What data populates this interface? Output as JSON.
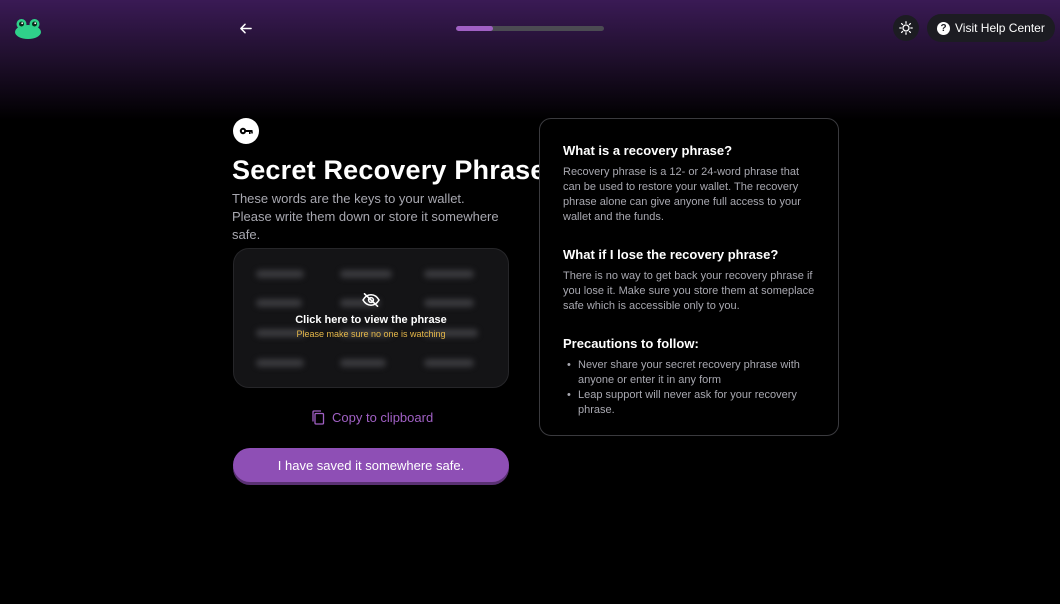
{
  "header": {
    "progress_fraction": 0.25,
    "help_label": "Visit Help Center"
  },
  "main": {
    "title": "Secret Recovery Phrase",
    "subtitle": "These words are the keys to your wallet. Please write them down or store it somewhere safe.",
    "reveal_title": "Click here to view the phrase",
    "reveal_hint": "Please make sure no one is watching",
    "copy_label": "Copy to clipboard",
    "primary_button": "I have saved it somewhere safe."
  },
  "info": {
    "q1_title": "What is a recovery phrase?",
    "q1_body": "Recovery phrase is a 12- or 24-word phrase that can be used to restore your wallet. The recovery phrase alone can give anyone full access to your wallet and the funds.",
    "q2_title": "What if I lose the recovery phrase?",
    "q2_body": "There is no way to get back your recovery phrase if you lose it. Make sure you store them at someplace safe which is accessible only to you.",
    "q3_title": "Precautions to follow:",
    "q3_items": [
      "Never share your secret recovery phrase with anyone or enter it in any form",
      "Leap support will never ask for your recovery phrase."
    ]
  },
  "colors": {
    "accent": "#8e4fb5",
    "accent_text": "#a060c4",
    "warning": "#e6b84a"
  },
  "icons": {
    "logo": "frog-logo-icon",
    "back": "arrow-left-icon",
    "theme": "sun-icon",
    "help": "question-circle-icon",
    "key": "key-icon",
    "hidden": "eye-off-icon",
    "copy": "copy-icon"
  }
}
